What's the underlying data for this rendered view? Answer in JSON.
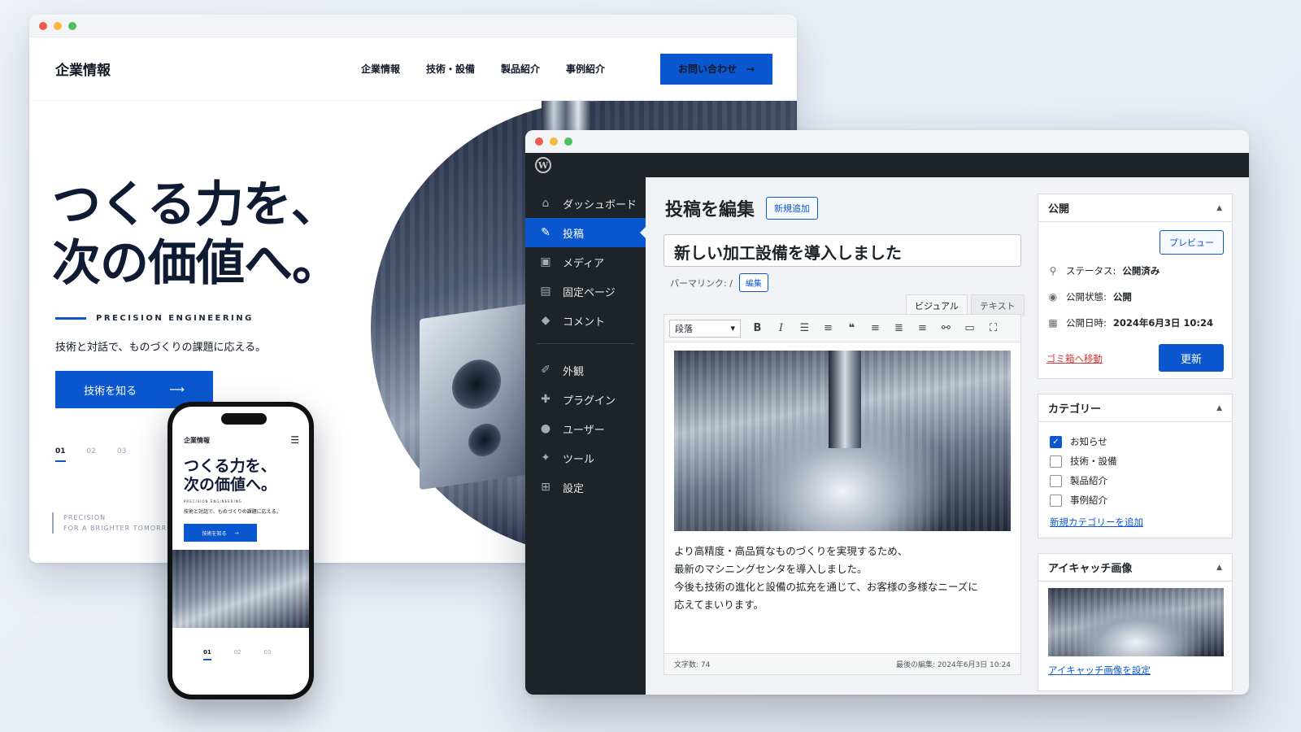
{
  "site": {
    "logo": "企業情報",
    "nav": [
      "企業情報",
      "技術・設備",
      "製品紹介",
      "事例紹介"
    ],
    "contact_label": "お問い合わせ",
    "hero_title_line1": "つくる力を、",
    "hero_title_line2": "次の価値へ。",
    "hero_tag": "PRECISION ENGINEERING",
    "hero_desc": "技術と対話で、ものづくりの課題に応える。",
    "cta_label": "技術を知る",
    "pages": [
      "01",
      "02",
      "03"
    ],
    "footer_line1": "PRECISION",
    "footer_line2": "FOR A BRIGHTER TOMORROW"
  },
  "phone": {
    "logo": "企業情報",
    "title_line1": "つくる力を、",
    "title_line2": "次の価値へ。",
    "tag": "PRECISION ENGINEERING",
    "desc": "技術と対話で、ものづくりの課題に応える。",
    "cta_label": "技術を知る",
    "pages": [
      "01",
      "02",
      "03"
    ]
  },
  "admin": {
    "sidebar": [
      {
        "label": "ダッシュボード",
        "icon": "dashboard-icon"
      },
      {
        "label": "投稿",
        "icon": "pin-icon"
      },
      {
        "label": "メディア",
        "icon": "media-icon"
      },
      {
        "label": "固定ページ",
        "icon": "page-icon"
      },
      {
        "label": "コメント",
        "icon": "comment-icon"
      },
      {
        "label": "外観",
        "icon": "brush-icon"
      },
      {
        "label": "プラグイン",
        "icon": "plugin-icon"
      },
      {
        "label": "ユーザー",
        "icon": "user-icon"
      },
      {
        "label": "ツール",
        "icon": "wrench-icon"
      },
      {
        "label": "設定",
        "icon": "settings-icon"
      }
    ],
    "page_title": "投稿を編集",
    "add_new": "新規追加",
    "post_title": "新しい加工設備を導入しました",
    "permalink_label": "パーマリンク: /",
    "permalink_edit": "編集",
    "tab_visual": "ビジュアル",
    "tab_text": "テキスト",
    "format_select": "段落",
    "body_lines": [
      "より高精度・高品質なものづくりを実現するため、",
      "最新のマシニングセンタを導入しました。",
      "今後も技術の進化と設備の拡充を通じて、お客様の多様なニーズに",
      "応えてまいります。"
    ],
    "word_count": "文字数: 74",
    "last_edit": "最後の編集: 2024年6月3日 10:24",
    "publish": {
      "heading": "公開",
      "preview": "プレビュー",
      "status_label": "ステータス:",
      "status_value": "公開済み",
      "visibility_label": "公開状態:",
      "visibility_value": "公開",
      "date_label": "公開日時:",
      "date_value": "2024年6月3日 10:24",
      "trash": "ゴミ箱へ移動",
      "update": "更新"
    },
    "categories": {
      "heading": "カテゴリー",
      "items": [
        {
          "label": "お知らせ",
          "checked": true
        },
        {
          "label": "技術・設備",
          "checked": false
        },
        {
          "label": "製品紹介",
          "checked": false
        },
        {
          "label": "事例紹介",
          "checked": false
        }
      ],
      "add_new": "新規カテゴリーを追加"
    },
    "featured": {
      "heading": "アイキャッチ画像",
      "set_link": "アイキャッチ画像を設定"
    }
  },
  "colors": {
    "accent": "#0b57d0",
    "admin_dark": "#1d2327",
    "danger": "#d63638"
  }
}
